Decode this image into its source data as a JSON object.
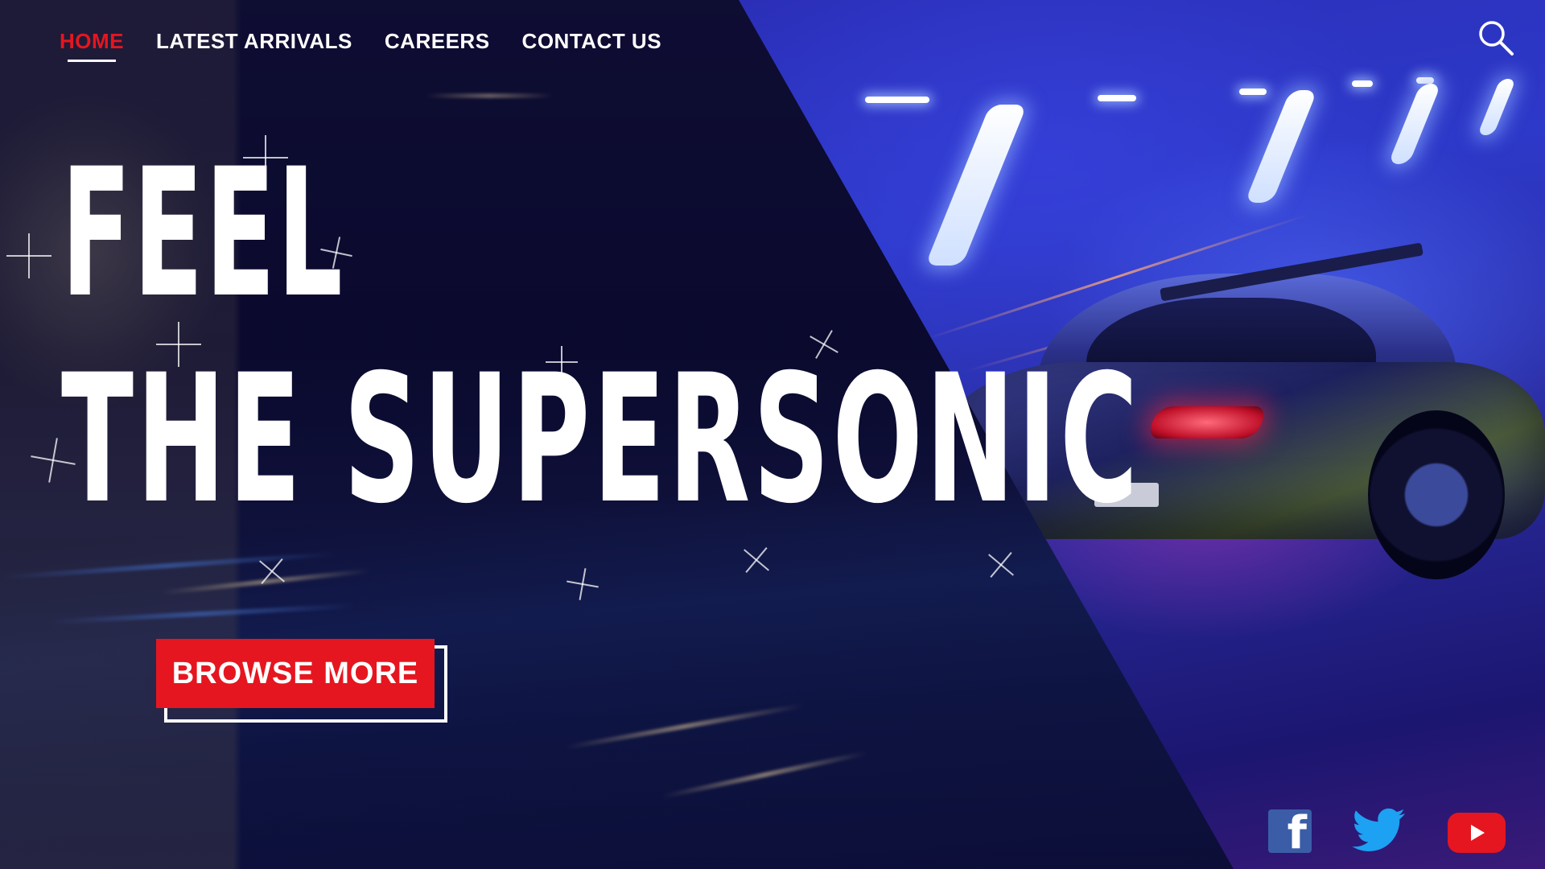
{
  "nav": {
    "items": [
      {
        "label": "HOME",
        "active": true
      },
      {
        "label": "LATEST ARRIVALS",
        "active": false
      },
      {
        "label": "CAREERS",
        "active": false
      },
      {
        "label": "CONTACT US",
        "active": false
      }
    ]
  },
  "search": {
    "icon": "search-icon"
  },
  "hero": {
    "line1": "FEEL",
    "line2": "THE SUPERSONIC",
    "cta_label": "BROWSE MORE",
    "background": "neon sports car in tunnel"
  },
  "social": [
    {
      "name": "facebook",
      "icon": "facebook-icon"
    },
    {
      "name": "twitter",
      "icon": "twitter-icon"
    },
    {
      "name": "youtube",
      "icon": "youtube-icon"
    }
  ],
  "colors": {
    "accent": "#e5161f",
    "text": "#ffffff",
    "background_dark": "#0a0a2e",
    "background_blue": "#2d39c9",
    "facebook": "#3b5da7",
    "twitter": "#1da1f2"
  }
}
